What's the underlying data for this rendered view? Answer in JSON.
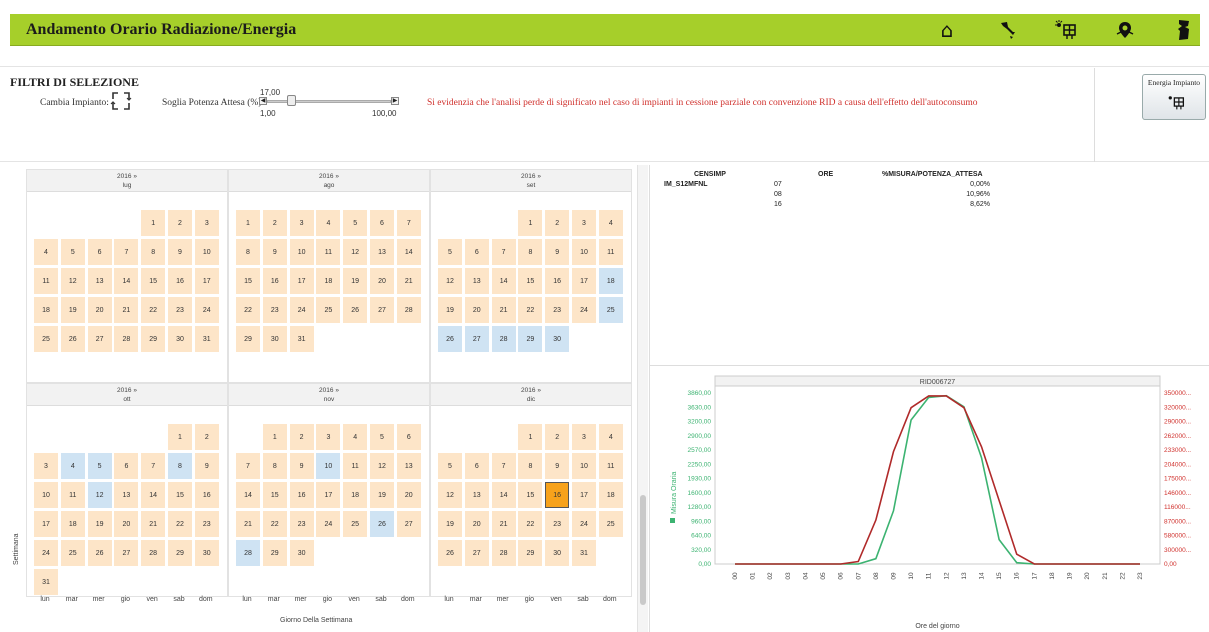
{
  "header": {
    "title": "Andamento Orario Radiazione/Energia",
    "icons": [
      "home-icon",
      "italy-map-icon",
      "solar-panel-icon",
      "map-pin-icon",
      "sardinia-map-icon"
    ]
  },
  "filters": {
    "title": "FILTRI DI SELEZIONE",
    "cambia_label": "Cambia Impianto:",
    "soglia_label": "Soglia Potenza Attesa (%)",
    "soglia_value": "17,00",
    "soglia_min": "1,00",
    "soglia_max": "100,00",
    "soglia_fraction": 0.162,
    "warning": "Si evidenzia che l'analisi perde di significato nel caso di impianti in cessione parziale con convenzione RID a causa dell'effetto dell'autoconsumo",
    "energia_button": "Energia Impianto"
  },
  "calendar": {
    "y_label": "Settimana",
    "x_label": "Giorno Della Settimana",
    "weekdays": [
      "lun",
      "mar",
      "mer",
      "gio",
      "ven",
      "sab",
      "dom"
    ],
    "months": [
      {
        "year": "2016 »",
        "name": "lug",
        "start": 4,
        "days": 31,
        "blue": [],
        "selected": []
      },
      {
        "year": "2016 »",
        "name": "ago",
        "start": 0,
        "days": 31,
        "blue": [],
        "selected": []
      },
      {
        "year": "2016 »",
        "name": "set",
        "start": 3,
        "days": 30,
        "blue": [
          18,
          25,
          26,
          27,
          28,
          29,
          30
        ],
        "selected": []
      },
      {
        "year": "2016 »",
        "name": "ott",
        "start": 5,
        "days": 31,
        "blue": [
          4,
          5,
          8,
          12
        ],
        "selected": []
      },
      {
        "year": "2016 »",
        "name": "nov",
        "start": 1,
        "days": 30,
        "blue": [
          10,
          26,
          28
        ],
        "selected": []
      },
      {
        "year": "2016 »",
        "name": "dic",
        "start": 3,
        "days": 31,
        "blue": [],
        "selected": [
          16
        ]
      }
    ]
  },
  "table": {
    "headers": [
      "CENSIMP",
      "ORE",
      "%MISURA/POTENZA_ATTESA"
    ],
    "rows": [
      [
        "IM_S12MFNL",
        "07",
        "0,00%"
      ],
      [
        "",
        "08",
        "10,96%"
      ],
      [
        "",
        "16",
        "8,62%"
      ]
    ]
  },
  "chart_data": {
    "type": "line",
    "title": "RID006727",
    "xlabel": "Ore del giorno",
    "ylabel_left": "Misura Oraria",
    "x": [
      "00",
      "01",
      "02",
      "03",
      "04",
      "05",
      "06",
      "07",
      "08",
      "09",
      "10",
      "11",
      "12",
      "13",
      "14",
      "15",
      "16",
      "17",
      "18",
      "19",
      "20",
      "21",
      "22",
      "23"
    ],
    "left_ticks": [
      "3860,00",
      "3630,00",
      "3200,00",
      "2900,00",
      "2570,00",
      "2250,00",
      "1930,00",
      "1600,00",
      "1280,00",
      "960,00",
      "640,00",
      "320,00",
      "0,00"
    ],
    "right_ticks": [
      "350000...",
      "320000...",
      "290000...",
      "262000...",
      "233000...",
      "204000...",
      "175000...",
      "146000...",
      "116000...",
      "870000...",
      "580000...",
      "300000...",
      "0,00"
    ],
    "ylim_left": [
      0,
      3860
    ],
    "ylim_right": [
      0,
      350000
    ],
    "series": [
      {
        "name": "Misura Oraria",
        "color": "#3cb371",
        "axis": "left",
        "values": [
          0,
          0,
          0,
          0,
          0,
          0,
          0,
          0,
          120,
          1200,
          3250,
          3760,
          3800,
          3550,
          2400,
          550,
          30,
          0,
          0,
          0,
          0,
          0,
          0,
          0
        ]
      },
      {
        "name": "",
        "color": "#b02a2a",
        "axis": "right",
        "values": [
          0,
          0,
          0,
          0,
          0,
          0,
          0,
          5000,
          90000,
          230000,
          320000,
          344000,
          344000,
          320000,
          240000,
          130000,
          20000,
          0,
          0,
          0,
          0,
          0,
          0,
          0
        ]
      }
    ]
  }
}
